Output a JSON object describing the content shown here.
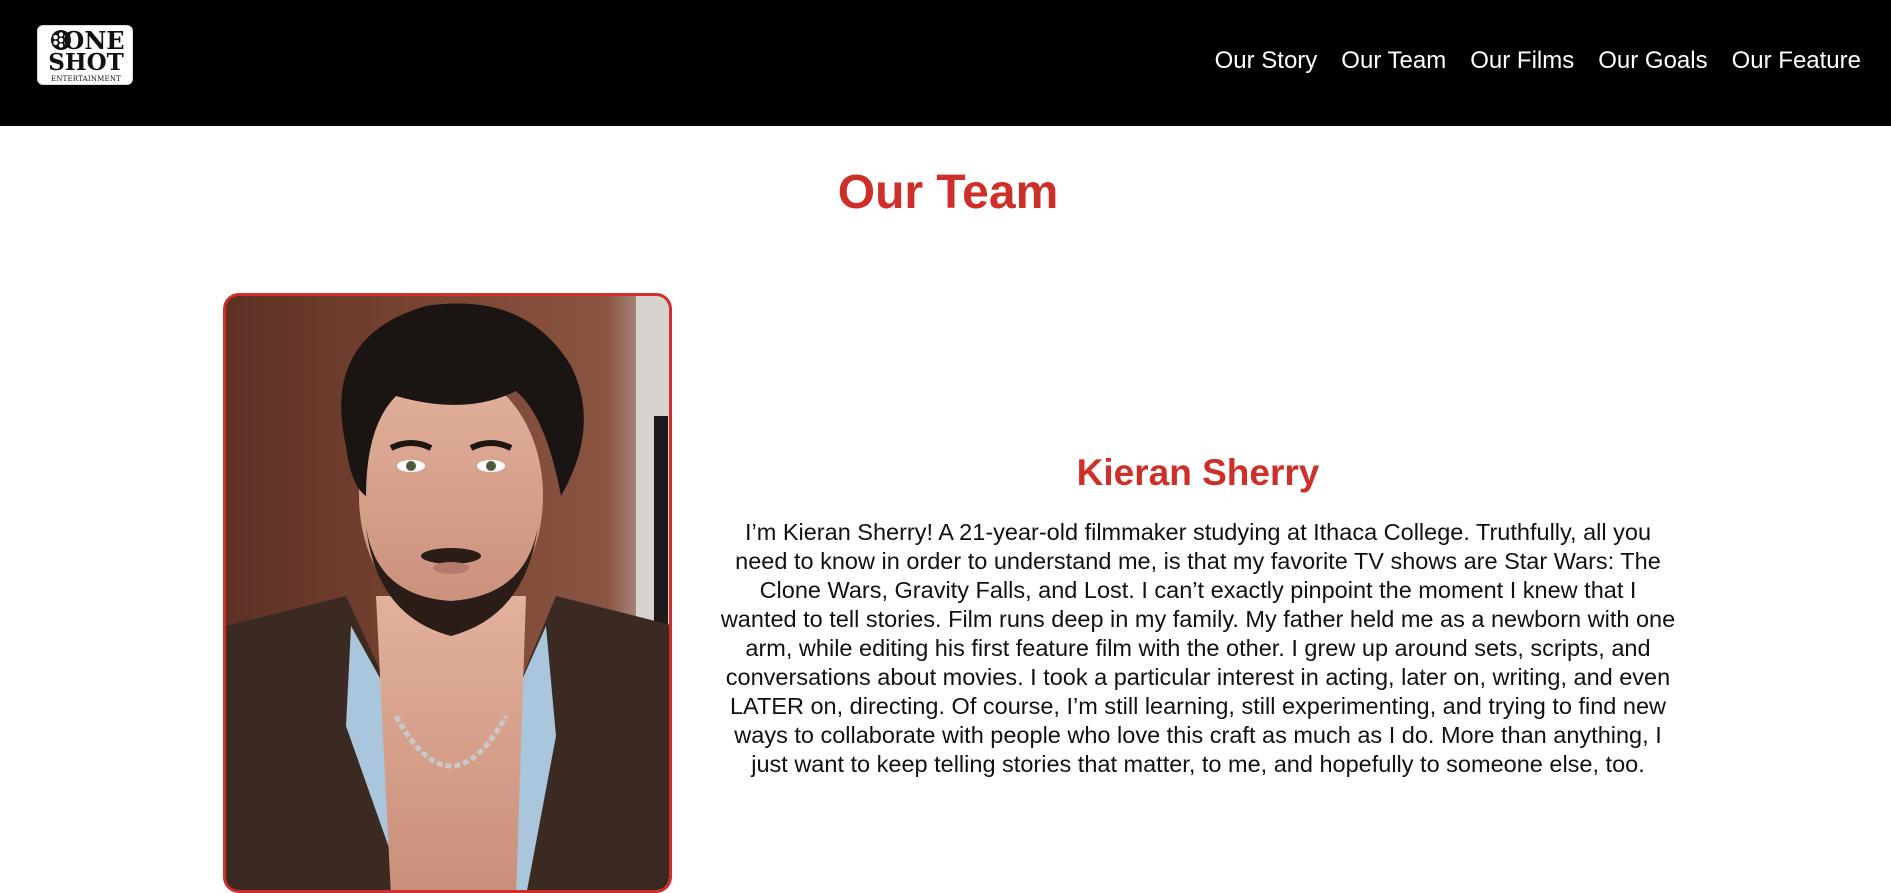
{
  "header": {
    "logo": {
      "line1": "ONE",
      "line2": "SHOT",
      "line3": "ENTERTAINMENT"
    },
    "nav": [
      {
        "label": "Our Story"
      },
      {
        "label": "Our Team"
      },
      {
        "label": "Our Films"
      },
      {
        "label": "Our Goals"
      },
      {
        "label": "Our Feature"
      }
    ]
  },
  "main": {
    "title": "Our Team",
    "member": {
      "name": "Kieran Sherry",
      "bio": "I’m Kieran Sherry! A 21-year-old filmmaker studying at Ithaca College. Truthfully, all you need to know in order to understand me, is that my favorite TV shows are Star Wars: The Clone Wars, Gravity Falls, and Lost. I can’t exactly pinpoint the moment I knew that I wanted to tell stories. Film runs deep in my family. My father held me as a newborn with one arm, while editing his first feature film with the other. I grew up around sets, scripts, and conversations about movies. I took a particular interest in acting, later on, writing, and even LATER on, directing. Of course, I’m still learning, still experimenting, and trying to find new ways to collaborate with people who love this craft as much as I do. More than anything, I just want to keep telling stories that matter, to me, and hopefully to someone else, too."
    }
  },
  "colors": {
    "header_bg": "#000000",
    "accent": "#cf2f29",
    "text": "#111111"
  }
}
